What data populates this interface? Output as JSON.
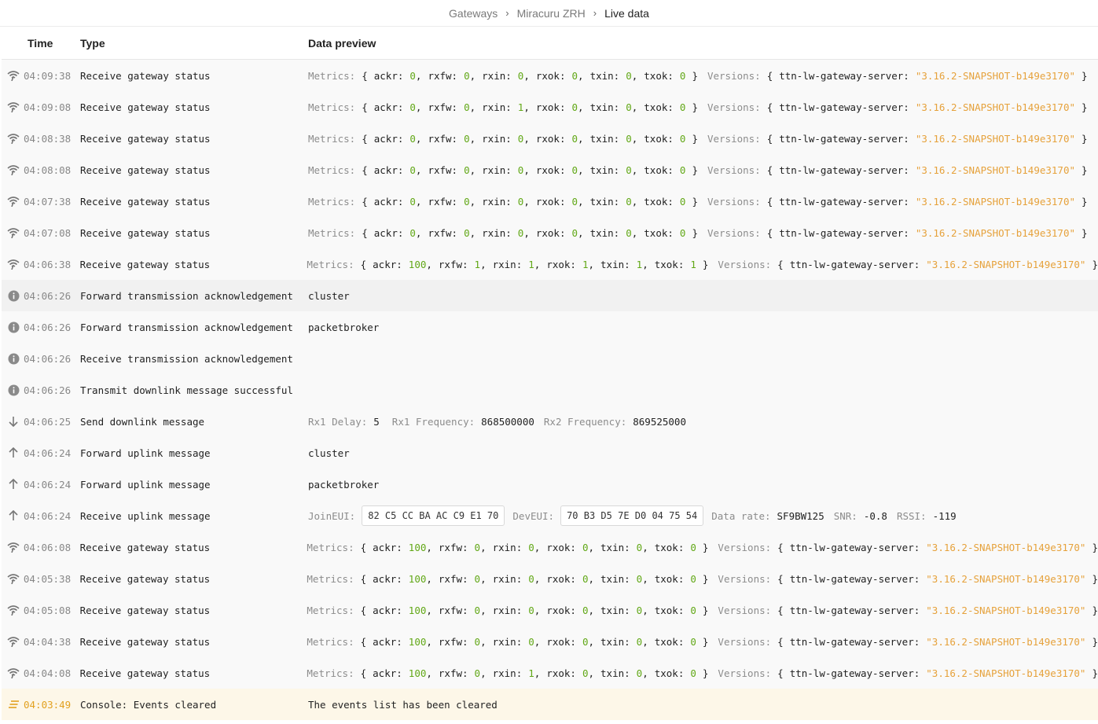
{
  "breadcrumb": [
    "Gateways",
    "Miracuru ZRH",
    "Live data"
  ],
  "columns": {
    "time": "Time",
    "type": "Type",
    "data": "Data preview"
  },
  "labels": {
    "metrics": "Metrics:",
    "versions": "Versions:",
    "ttn_key": "ttn-lw-gateway-server:",
    "version_value": "\"3.16.2-SNAPSHOT-b149e3170\"",
    "rx1_delay": "Rx1 Delay:",
    "rx1_freq": "Rx1 Frequency:",
    "rx2_freq": "Rx2 Frequency:",
    "join_eui": "JoinEUI:",
    "dev_eui": "DevEUI:",
    "data_rate": "Data rate:",
    "snr": "SNR:",
    "rssi": "RSSI:"
  },
  "icons": {
    "status": "wifi-icon",
    "info": "info-icon",
    "down": "arrow-down-icon",
    "up": "arrow-up-icon",
    "console": "list-icon"
  },
  "colors": {
    "green_value": "#62a817",
    "orange_value": "#e6a23c",
    "warn_row": "#fdf7e8"
  },
  "rows": [
    {
      "icon": "status",
      "time": "04:09:38",
      "type": "Receive gateway status",
      "kind": "status",
      "m": {
        "ackr": "0",
        "rxfw": "0",
        "rxin": "0",
        "rxok": "0",
        "txin": "0",
        "txok": "0"
      }
    },
    {
      "icon": "status",
      "time": "04:09:08",
      "type": "Receive gateway status",
      "kind": "status",
      "m": {
        "ackr": "0",
        "rxfw": "0",
        "rxin": "1",
        "rxok": "0",
        "txin": "0",
        "txok": "0"
      }
    },
    {
      "icon": "status",
      "time": "04:08:38",
      "type": "Receive gateway status",
      "kind": "status",
      "m": {
        "ackr": "0",
        "rxfw": "0",
        "rxin": "0",
        "rxok": "0",
        "txin": "0",
        "txok": "0"
      }
    },
    {
      "icon": "status",
      "time": "04:08:08",
      "type": "Receive gateway status",
      "kind": "status",
      "m": {
        "ackr": "0",
        "rxfw": "0",
        "rxin": "0",
        "rxok": "0",
        "txin": "0",
        "txok": "0"
      }
    },
    {
      "icon": "status",
      "time": "04:07:38",
      "type": "Receive gateway status",
      "kind": "status",
      "m": {
        "ackr": "0",
        "rxfw": "0",
        "rxin": "0",
        "rxok": "0",
        "txin": "0",
        "txok": "0"
      }
    },
    {
      "icon": "status",
      "time": "04:07:08",
      "type": "Receive gateway status",
      "kind": "status",
      "m": {
        "ackr": "0",
        "rxfw": "0",
        "rxin": "0",
        "rxok": "0",
        "txin": "0",
        "txok": "0"
      }
    },
    {
      "icon": "status",
      "time": "04:06:38",
      "type": "Receive gateway status",
      "kind": "status",
      "m": {
        "ackr": "100",
        "rxfw": "1",
        "rxin": "1",
        "rxok": "1",
        "txin": "1",
        "txok": "1"
      }
    },
    {
      "icon": "info",
      "time": "04:06:26",
      "type": "Forward transmission acknowledgement",
      "kind": "text",
      "text": "cluster",
      "highlight": true
    },
    {
      "icon": "info",
      "time": "04:06:26",
      "type": "Forward transmission acknowledgement",
      "kind": "text",
      "text": "packetbroker"
    },
    {
      "icon": "info",
      "time": "04:06:26",
      "type": "Receive transmission acknowledgement",
      "kind": "text",
      "text": ""
    },
    {
      "icon": "info",
      "time": "04:06:26",
      "type": "Transmit downlink message successful",
      "kind": "text",
      "text": ""
    },
    {
      "icon": "down",
      "time": "04:06:25",
      "type": "Send downlink message",
      "kind": "downlink",
      "rx1_delay": "5",
      "rx1_freq": "868500000",
      "rx2_freq": "869525000"
    },
    {
      "icon": "up",
      "time": "04:06:24",
      "type": "Forward uplink message",
      "kind": "text",
      "text": "cluster"
    },
    {
      "icon": "up",
      "time": "04:06:24",
      "type": "Forward uplink message",
      "kind": "text",
      "text": "packetbroker"
    },
    {
      "icon": "up",
      "time": "04:06:24",
      "type": "Receive uplink message",
      "kind": "uplink",
      "join_eui": "82 C5 CC BA AC C9 E1 70",
      "dev_eui": "70 B3 D5 7E D0 04 75 54",
      "data_rate": "SF9BW125",
      "snr": "-0.8",
      "rssi": "-119"
    },
    {
      "icon": "status",
      "time": "04:06:08",
      "type": "Receive gateway status",
      "kind": "status",
      "m": {
        "ackr": "100",
        "rxfw": "0",
        "rxin": "0",
        "rxok": "0",
        "txin": "0",
        "txok": "0"
      }
    },
    {
      "icon": "status",
      "time": "04:05:38",
      "type": "Receive gateway status",
      "kind": "status",
      "m": {
        "ackr": "100",
        "rxfw": "0",
        "rxin": "0",
        "rxok": "0",
        "txin": "0",
        "txok": "0"
      }
    },
    {
      "icon": "status",
      "time": "04:05:08",
      "type": "Receive gateway status",
      "kind": "status",
      "m": {
        "ackr": "100",
        "rxfw": "0",
        "rxin": "0",
        "rxok": "0",
        "txin": "0",
        "txok": "0"
      }
    },
    {
      "icon": "status",
      "time": "04:04:38",
      "type": "Receive gateway status",
      "kind": "status",
      "m": {
        "ackr": "100",
        "rxfw": "0",
        "rxin": "0",
        "rxok": "0",
        "txin": "0",
        "txok": "0"
      }
    },
    {
      "icon": "status",
      "time": "04:04:08",
      "type": "Receive gateway status",
      "kind": "status",
      "m": {
        "ackr": "100",
        "rxfw": "0",
        "rxin": "1",
        "rxok": "0",
        "txin": "0",
        "txok": "0"
      }
    },
    {
      "icon": "console",
      "time": "04:03:49",
      "type": "Console: Events cleared",
      "kind": "text",
      "text": "The events list has been cleared",
      "warn": true
    }
  ]
}
